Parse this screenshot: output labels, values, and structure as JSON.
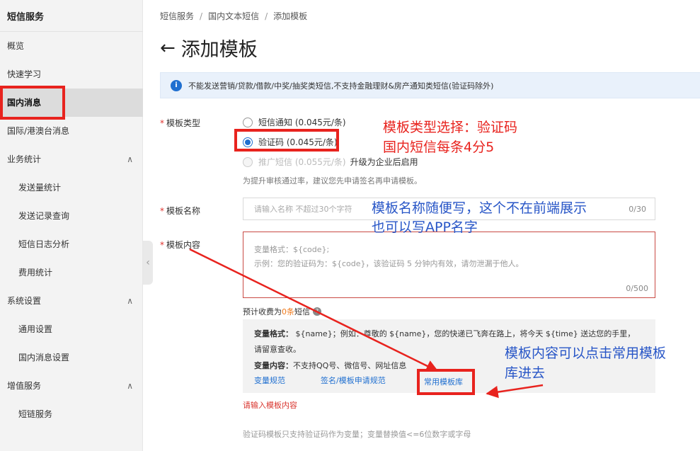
{
  "sidebar": {
    "title": "短信服务",
    "items": [
      {
        "label": "概览"
      },
      {
        "label": "快速学习"
      },
      {
        "label": "国内消息"
      },
      {
        "label": "国际/港澳台消息"
      },
      {
        "label": "业务统计"
      },
      {
        "label": "发送量统计"
      },
      {
        "label": "发送记录查询"
      },
      {
        "label": "短信日志分析"
      },
      {
        "label": "费用统计"
      },
      {
        "label": "系统设置"
      },
      {
        "label": "通用设置"
      },
      {
        "label": "国内消息设置"
      },
      {
        "label": "增值服务"
      },
      {
        "label": "短链服务"
      }
    ],
    "caret": "∧"
  },
  "breadcrumb": [
    "短信服务",
    "国内文本短信",
    "添加模板"
  ],
  "page_title": "添加模板",
  "notice": "不能发送营销/贷款/借款/中奖/抽奖类短信,不支持金融理财&房产通知类短信(验证码除外)",
  "form": {
    "type_label": "模板类型",
    "type_options": {
      "notify": "短信通知 (0.045元/条)",
      "verify": "验证码 (0.045元/条)",
      "promo": "推广短信 (0.055元/条)",
      "promo_note": "升级为企业后启用"
    },
    "type_hint": "为提升审核通过率，建议您先申请签名再申请模板。",
    "name_label": "模板名称",
    "name_placeholder": "请输入名称 不超过30个字符",
    "name_counter": "0/30",
    "content_label": "模板内容",
    "content_placeholder_1": "变量格式：${code};",
    "content_placeholder_2": "示例：您的验证码为：${code}，该验证码 5 分钟内有效，请勿泄漏于他人。",
    "content_counter": "0/500",
    "fee_prefix": "预计收费为",
    "fee_count": "0条",
    "fee_suffix": "短信",
    "var_format_label": "变量格式：",
    "var_format_text": "${name}；例如：尊敬的 ${name}，您的快递已飞奔在路上，将今天 ${time} 送达您的手里，",
    "var_format_text2": "请留意查收。",
    "var_content_label": "变量内容：",
    "var_content_text": "不支持QQ号、微信号、网址信息",
    "link_var_rules": "变量规范",
    "link_sign_rules": "签名/模板申请规范",
    "link_common_templates": "常用模板库",
    "error": "请输入模板内容",
    "footnote": "验证码模板只支持验证码作为变量；变量替换值<=6位数字或字母"
  },
  "annotations": {
    "type_note_1": "模板类型选择：验证码",
    "type_note_2": "国内短信每条4分5",
    "name_note_1": "模板名称随便写，这个不在前端展示",
    "name_note_2": "也可以写APP名字",
    "content_note_1": "模板内容可以点击常用模板",
    "content_note_2": "库进去"
  },
  "colors": {
    "annotation_red": "#e8231e",
    "annotation_blue": "#2856c7",
    "primary": "#1f6fd0",
    "fee_highlight": "#f07b1d"
  }
}
